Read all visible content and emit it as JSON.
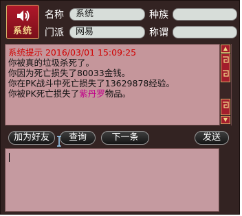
{
  "header": {
    "system_icon_label": "系统",
    "fields": {
      "name_label": "名称",
      "name_value": "系统",
      "race_label": "种族",
      "race_value": "",
      "sect_label": "门派",
      "sect_value": "网易",
      "title_label": "称谓",
      "title_value": ""
    }
  },
  "messages": {
    "header_line": "系统提示 2016/03/01 15:09:25",
    "line1": "你被真的垃圾杀死了。",
    "line2": "你因为死亡损失了80033金钱。",
    "line3": "你在PK战斗中死亡损失了13629878经验。",
    "line4_prefix": "你被PK死亡损失了",
    "line4_item": "紫丹罗",
    "line4_suffix": "物品。"
  },
  "buttons": {
    "add_friend": "加为好友",
    "query": "查询",
    "next": "下一条",
    "send": "发送"
  },
  "input": {
    "value": ""
  }
}
